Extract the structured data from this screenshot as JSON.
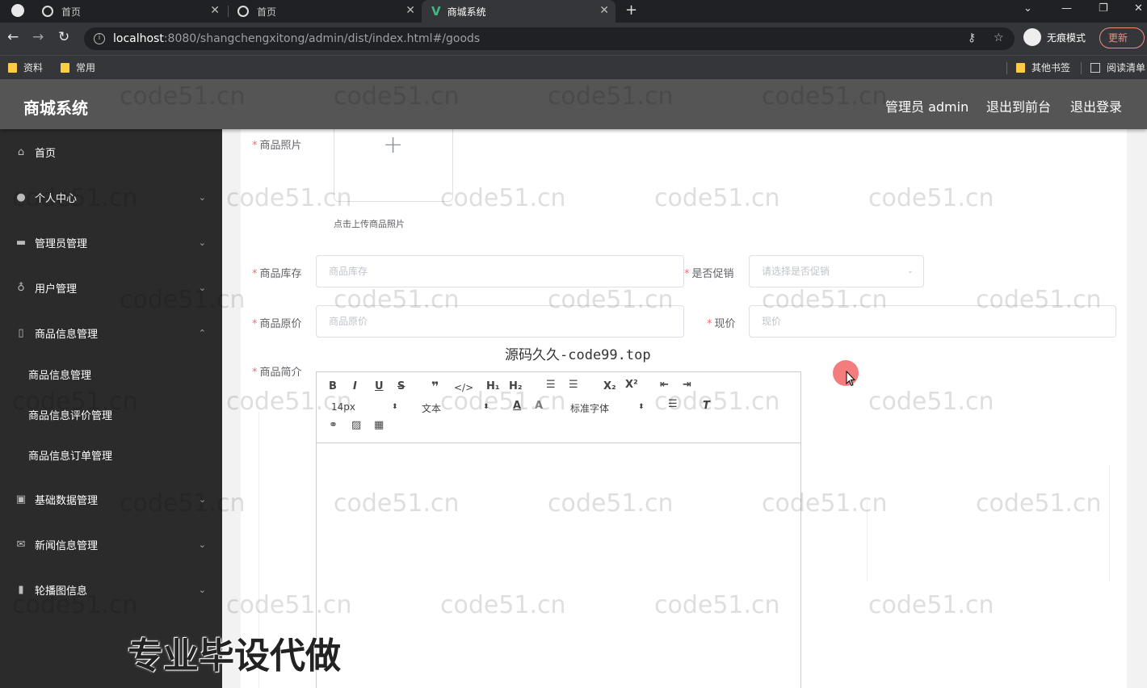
{
  "browser": {
    "tabs": [
      {
        "label": "首页"
      },
      {
        "label": "首页"
      },
      {
        "label": "商城系统"
      }
    ],
    "url_host": "localhost",
    "url_path": ":8080/shangchengxitong/admin/dist/index.html#/goods",
    "incognito_label": "无痕模式",
    "update_label": "更新",
    "bookmarks": [
      {
        "label": "资料"
      },
      {
        "label": "常用"
      },
      {
        "label": "其他书签"
      },
      {
        "label": "阅读清单"
      }
    ]
  },
  "header": {
    "title": "商城系统",
    "admin_label": "管理员 admin",
    "front_label": "退出到前台",
    "logout_label": "退出登录"
  },
  "sidebar": {
    "items": [
      {
        "label": "首页",
        "icon": "home-icon"
      },
      {
        "label": "个人中心",
        "icon": "user-icon"
      },
      {
        "label": "管理员管理",
        "icon": "chat-icon"
      },
      {
        "label": "用户管理",
        "icon": "mic-icon"
      },
      {
        "label": "商品信息管理",
        "icon": "phone-icon"
      },
      {
        "label": "基础数据管理",
        "icon": "clipboard-icon"
      },
      {
        "label": "新闻信息管理",
        "icon": "mail-icon"
      },
      {
        "label": "轮播图信息",
        "icon": "bar-chart-icon"
      }
    ],
    "sub_items": [
      {
        "label": "商品信息管理"
      },
      {
        "label": "商品信息评价管理"
      },
      {
        "label": "商品信息订单管理"
      }
    ]
  },
  "form": {
    "photo_label": "商品照片",
    "photo_tip": "点击上传商品照片",
    "stock_label": "商品库存",
    "stock_placeholder": "商品库存",
    "promo_label": "是否促销",
    "promo_placeholder": "请选择是否促销",
    "orig_price_label": "商品原价",
    "orig_price_placeholder": "商品原价",
    "price_label": "现价",
    "price_placeholder": "现价",
    "intro_label": "商品简介"
  },
  "editor": {
    "font_size": "14px",
    "block_format": "文本",
    "font_family": "标准字体"
  },
  "watermarks": {
    "repeat": "code51.cn",
    "center": "源码久久-code99.top",
    "bottom": "专业毕设代做"
  }
}
